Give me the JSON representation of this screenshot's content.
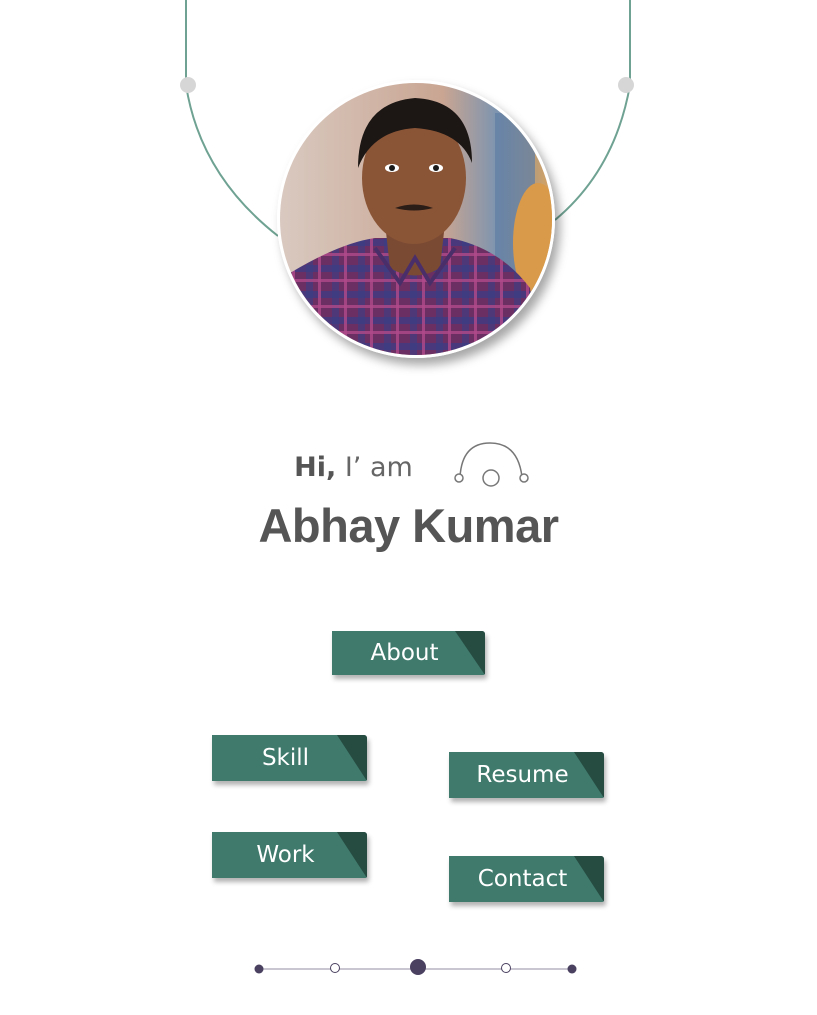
{
  "greeting": {
    "hi": "Hi,",
    "iam": " I’ am"
  },
  "profile": {
    "name": "Abhay Kumar"
  },
  "nav": {
    "about": "About",
    "skill": "Skill",
    "resume": "Resume",
    "work": "Work",
    "contact": "Contact"
  },
  "icons": {
    "wave": "arc-dots-icon",
    "avatar": "profile-photo"
  },
  "pager": {
    "active_index": 2,
    "total": 5
  },
  "colors": {
    "button": "#3f7a6c",
    "button_corner": "#264b41",
    "arc": "#6fa292",
    "text": "#555555",
    "pager_dot": "#4a4060"
  }
}
